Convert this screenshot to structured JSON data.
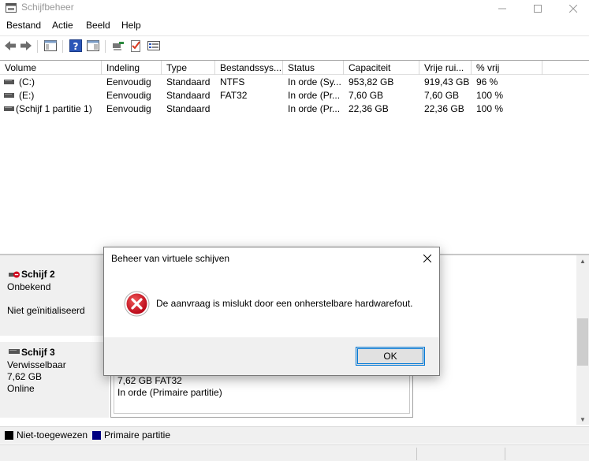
{
  "window": {
    "title": "Schijfbeheer",
    "icon": "disk-management-icon"
  },
  "menu": [
    "Bestand",
    "Actie",
    "Beeld",
    "Help"
  ],
  "toolbar": {
    "icons": [
      "back-arrow-icon",
      "forward-arrow-icon",
      "console-tree-icon",
      "help-icon",
      "properties-pane-icon",
      "connect-icon",
      "checklist-icon",
      "list-view-icon"
    ]
  },
  "volume_list": {
    "columns": [
      "Volume",
      "Indeling",
      "Type",
      "Bestandssys...",
      "Status",
      "Capaciteit",
      "Vrije rui...",
      "% vrij"
    ],
    "rows": [
      [
        "(C:)",
        "Eenvoudig",
        "Standaard",
        "NTFS",
        "In orde (Sy...",
        "953,82 GB",
        "919,43 GB",
        "96 %"
      ],
      [
        "(E:)",
        "Eenvoudig",
        "Standaard",
        "FAT32",
        "In orde (Pr...",
        "7,60 GB",
        "7,60 GB",
        "100 %"
      ],
      [
        "(Schijf 1 partitie 1)",
        "Eenvoudig",
        "Standaard",
        "",
        "In orde (Pr...",
        "22,36 GB",
        "22,36 GB",
        "100 %"
      ]
    ]
  },
  "disks": {
    "disk2": {
      "name": "Schijf 2",
      "type": "Onbekend",
      "status": "Niet geïnitialiseerd"
    },
    "disk3": {
      "name": "Schijf 3",
      "type": "Verwisselbaar",
      "size": "7,62 GB",
      "status": "Online",
      "partition_size_fs": "7,62 GB FAT32",
      "partition_status": "In orde (Primaire partitie)"
    }
  },
  "legend": [
    {
      "label": "Niet-toegewezen",
      "color": "#000000"
    },
    {
      "label": "Primaire partitie",
      "color": "#000080"
    }
  ],
  "dialog": {
    "title": "Beheer van virtuele schijven",
    "message": "De aanvraag is mislukt door een onherstelbare hardwarefout.",
    "ok_label": "OK",
    "icon": "error-icon",
    "error_color": "#d0021b"
  }
}
